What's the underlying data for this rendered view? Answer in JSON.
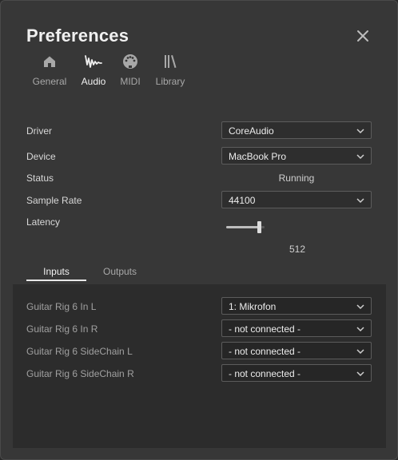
{
  "window": {
    "title": "Preferences"
  },
  "nav": [
    {
      "label": "General",
      "icon": "home-icon",
      "active": false
    },
    {
      "label": "Audio",
      "icon": "audio-waveform-icon",
      "active": true
    },
    {
      "label": "MIDI",
      "icon": "midi-connector-icon",
      "active": false
    },
    {
      "label": "Library",
      "icon": "library-icon",
      "active": false
    }
  ],
  "audio": {
    "driver": {
      "label": "Driver",
      "value": "CoreAudio"
    },
    "device": {
      "label": "Device",
      "value": "MacBook Pro"
    },
    "status": {
      "label": "Status",
      "value": "Running"
    },
    "sample_rate": {
      "label": "Sample Rate",
      "value": "44100"
    },
    "latency": {
      "label": "Latency",
      "value": "512",
      "slider_fraction": 0.9
    }
  },
  "io_tabs": [
    {
      "label": "Inputs",
      "active": true
    },
    {
      "label": "Outputs",
      "active": false
    }
  ],
  "inputs": [
    {
      "label": "Guitar Rig 6 In L",
      "value": "1: Mikrofon"
    },
    {
      "label": "Guitar Rig 6 In R",
      "value": "- not connected -"
    },
    {
      "label": "Guitar Rig 6 SideChain L",
      "value": "- not connected -"
    },
    {
      "label": "Guitar Rig 6 SideChain R",
      "value": "- not connected -"
    }
  ],
  "colors": {
    "background": "#373737",
    "panel": "#2c2c2c",
    "text_active": "#f2f2f2"
  }
}
